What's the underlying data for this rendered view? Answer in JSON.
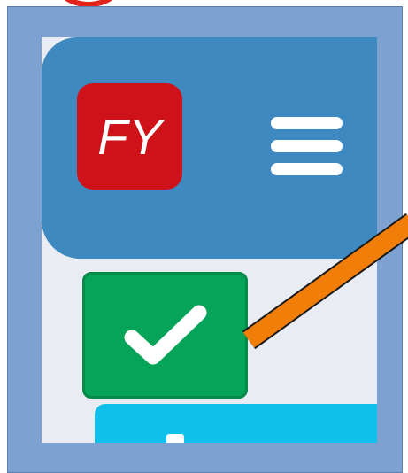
{
  "logo": {
    "text": "FY",
    "color": "#cf1119"
  },
  "header": {
    "color": "#3e8ac0",
    "menu_icon": "hamburger-menu-icon"
  },
  "check_button": {
    "icon": "checkmark-icon",
    "color": "#05a459"
  },
  "secondary_button": {
    "color": "#10bfea"
  },
  "annotation": {
    "pointer_color": "#f27e0a",
    "frame_color": "#7da2d2",
    "highlight_ring_color": "#e2231a"
  }
}
